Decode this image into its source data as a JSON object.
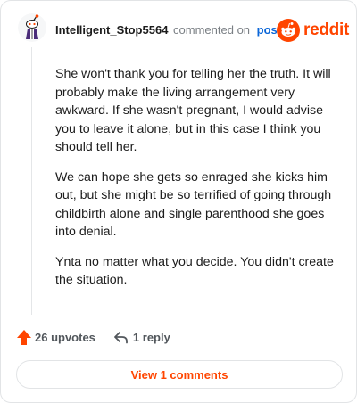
{
  "comment": {
    "username": "Intelligent_Stop5564",
    "action": "commented on",
    "post_link": "post",
    "brand": "reddit",
    "paragraphs": [
      "She won't thank you for telling her the truth. It will probably make the living arrangement very awkward. If she wasn't pregnant, I would advise you to leave it alone, but in this case I think you should tell her.",
      "We can hope she gets so enraged she kicks him out, but she might be so terrified of going through childbirth alone and single parenthood she goes into denial.",
      "Ynta no matter what you decide. You didn't create the situation."
    ],
    "upvotes_label": "26 upvotes",
    "reply_label": "1 reply",
    "view_comments_label": "View 1 comments"
  },
  "icons": {
    "avatar": "snoo-avatar",
    "logo": "reddit-logo-icon",
    "upvote": "upvote-arrow-icon",
    "reply": "reply-arrow-icon"
  },
  "colors": {
    "brand": "#ff4500",
    "link": "#0a66d8",
    "muted": "#7a7f84",
    "border": "#e2e4e6"
  }
}
